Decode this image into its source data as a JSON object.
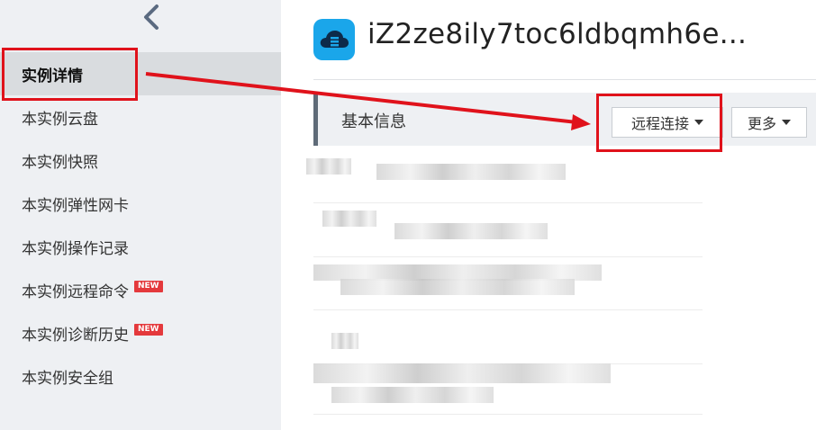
{
  "sidebar": {
    "back_icon": "chevron-left-icon",
    "items": [
      {
        "label": "实例详情",
        "active": true,
        "badge": ""
      },
      {
        "label": "本实例云盘",
        "active": false,
        "badge": ""
      },
      {
        "label": "本实例快照",
        "active": false,
        "badge": ""
      },
      {
        "label": "本实例弹性网卡",
        "active": false,
        "badge": ""
      },
      {
        "label": "本实例操作记录",
        "active": false,
        "badge": ""
      },
      {
        "label": "本实例远程命令",
        "active": false,
        "badge": "NEW"
      },
      {
        "label": "本实例诊断历史",
        "active": false,
        "badge": "NEW"
      },
      {
        "label": "本实例安全组",
        "active": false,
        "badge": ""
      }
    ]
  },
  "header": {
    "icon": "cloud-server-icon",
    "title": "iZ2ze8ily7toc6ldbqmh6e..."
  },
  "section": {
    "title": "基本信息",
    "remote_connect_label": "远程连接",
    "more_label": "更多"
  },
  "colors": {
    "accent_blue": "#1aa6ea",
    "annotation_red": "#e0121b",
    "badge_red": "#e4393c",
    "sidebar_bg": "#eef0f3"
  }
}
